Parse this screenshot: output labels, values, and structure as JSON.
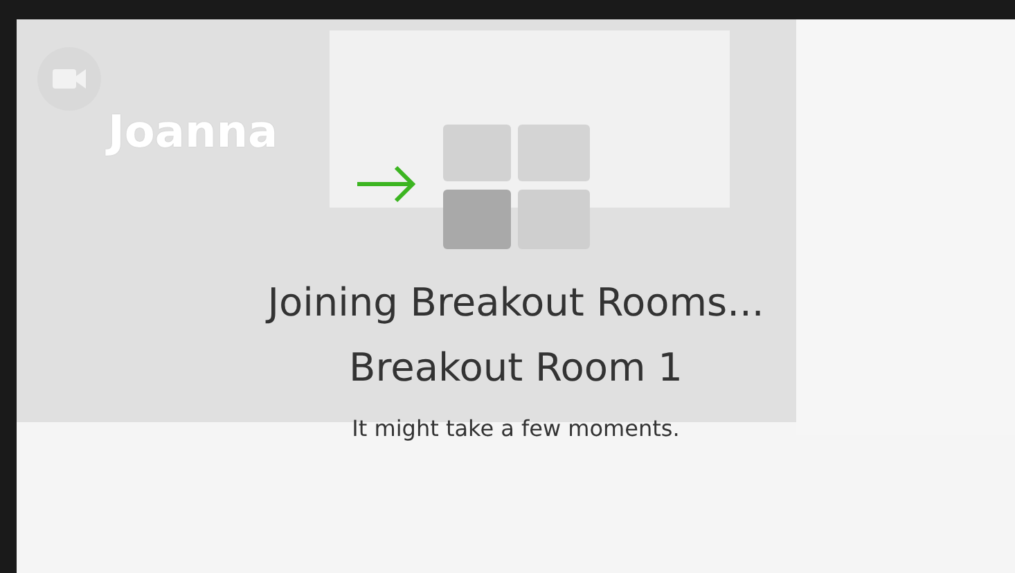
{
  "background_meeting": {
    "participant_name": "Joanna"
  },
  "overlay": {
    "title": "Joining Breakout Rooms...",
    "room_name": "Breakout Room 1",
    "message": "It might take a few moments."
  }
}
